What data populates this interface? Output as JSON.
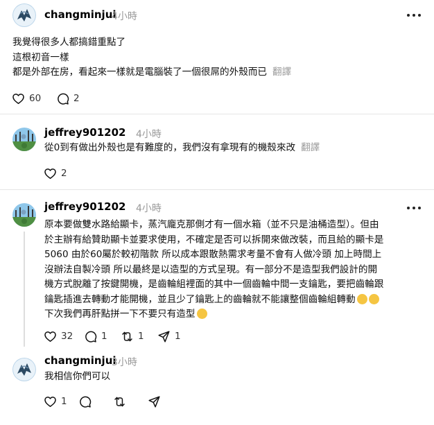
{
  "post1": {
    "username": "changminjui",
    "time": "4小時",
    "lines": [
      "我覺得很多人都搞錯重點了",
      "這根初音一樣",
      "都是外部在房，看起來一樣就是電腦裝了一個很屌的外殼而已"
    ],
    "translate": "翻譯",
    "likes": "60",
    "comments": "2"
  },
  "reply1": {
    "username": "jeffrey901202",
    "time": "4小時",
    "text": "從0到有做出外殼也是有難度的，我們沒有拿現有的機殼來改",
    "translate": "翻譯",
    "likes": "2"
  },
  "reply2": {
    "username": "jeffrey901202",
    "time": "4小時",
    "lines": [
      "原本要做雙水路給顯卡，蒸汽龐克那側才有一個水箱（並不只是油桶造型）。但由",
      "於主辦有給贊助顯卡並要求使用，不確定是否可以拆開來做改裝，而且給的顯卡是",
      "5060 由於60屬於較初階款 所以成本跟散熱需求考量不會有人做冷頭 加上時間上",
      "沒辦法自製冷頭 所以最終是以造型的方式呈現。有一部分不是造型我們設計的開",
      "機方式脫離了按鍵開機，是齒輪組裡面的其中一個齒輪中間一支鑰匙，要把齒輪跟",
      "鑰匙插進去轉動才能開機，並且少了鑰匙上的齒輪就不能讓整個齒輪組轉動",
      "下次我們再肝點拼一下不要只有造型"
    ],
    "likes": "32",
    "comments": "1",
    "reposts": "1",
    "shares": "1"
  },
  "reply3": {
    "username": "changminjui",
    "time": "3小時",
    "text": "我相信你們可以",
    "likes": "1"
  },
  "colors": {
    "muted": "#999999",
    "divider": "#e6e6e6",
    "emoji": "#f5c542"
  },
  "icons": [
    "heart-icon",
    "comment-icon",
    "repost-icon",
    "share-icon",
    "more-icon"
  ]
}
